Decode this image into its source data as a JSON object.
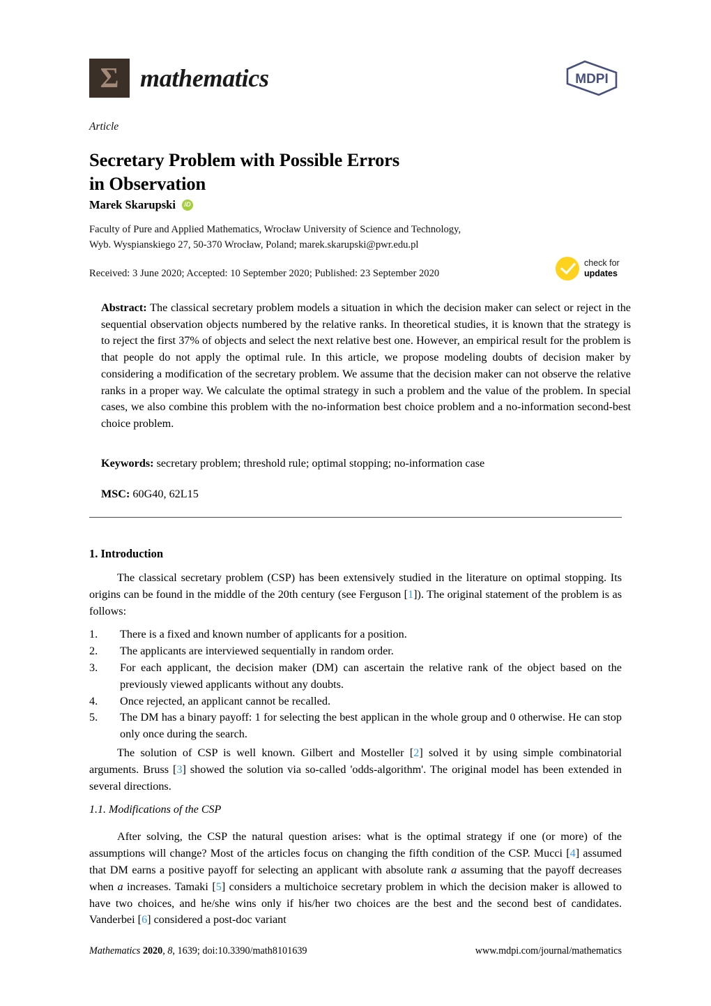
{
  "journal": {
    "logo_sigma": "Σ",
    "name": "mathematics",
    "publisher_logo_text": "MDPI"
  },
  "article": {
    "kind": "Article",
    "title_line1": "Secretary Problem with Possible Errors",
    "title_line2": "in Observation",
    "author": "Marek Skarupski",
    "orcid_label": "iD",
    "affiliation_line1": "Faculty of Pure and Applied Mathematics, Wrocław University of Science and Technology,",
    "affiliation_line2": "Wyb. Wyspianskiego 27, 50-370 Wrocław, Poland; marek.skarupski@pwr.edu.pl",
    "dates": "Received: 3 June 2020; Accepted: 10 September 2020; Published: 23 September 2020"
  },
  "check_updates": {
    "line1": "check for",
    "line2": "updates",
    "color": "#ffd21e"
  },
  "abstract": {
    "label": "Abstract:",
    "text": "The classical secretary problem models a situation in which the decision maker can select or reject in the sequential observation objects numbered by the relative ranks. In theoretical studies, it is known that the strategy is to reject the first 37% of objects and select the next relative best one. However, an empirical result for the problem is that people do not apply the optimal rule. In this article, we propose modeling doubts of decision maker by considering a modification of the secretary problem. We assume that the decision maker can not observe the relative ranks in a proper way. We calculate the optimal strategy in such a problem and the value of the problem. In special cases, we also combine this problem with the no-information best choice problem and a no-information second-best choice problem."
  },
  "keywords": {
    "label": "Keywords:",
    "text": "secretary problem; threshold rule; optimal stopping; no-information case"
  },
  "msc": {
    "label": "MSC:",
    "text": "60G40, 62L15"
  },
  "sections": {
    "intro_heading": "1. Introduction",
    "intro_para_a": "The classical secretary problem (CSP) has been extensively studied in the literature on optimal stopping. Its origins can be found in the middle of the 20th century (see Ferguson [",
    "intro_cite_1": "1",
    "intro_para_b": "]). The original statement of the problem is as follows:",
    "list": [
      {
        "num": "1.",
        "text": "There is a fixed and known number of applicants for a position."
      },
      {
        "num": "2.",
        "text": "The applicants are interviewed sequentially in random order."
      },
      {
        "num": "3.",
        "text": "For each applicant, the decision maker (DM) can ascertain the relative rank of the object based on the previously viewed applicants without any doubts."
      },
      {
        "num": "4.",
        "text": "Once rejected, an applicant cannot be recalled."
      },
      {
        "num": "5.",
        "text": "The DM has a binary payoff: 1 for selecting the best applican in the whole group and 0 otherwise. He can stop only once during the search."
      }
    ],
    "solution_para_a": "The solution of CSP is well known. Gilbert and Mosteller [",
    "solution_cite_2": "2",
    "solution_para_b": "] solved it by using simple combinatorial arguments. Bruss [",
    "solution_cite_3": "3",
    "solution_para_c": "] showed the solution via so-called 'odds-algorithm'. The original model has been extended in several directions.",
    "subsection_heading": "1.1. Modifications of the CSP",
    "mod_para_a": "After solving, the CSP the natural question arises: what is the optimal strategy if one (or more) of the assumptions will change? Most of the articles focus on changing the fifth condition of the CSP. Mucci [",
    "mod_cite_4": "4",
    "mod_para_b": "] assumed that DM earns a positive payoff for selecting an applicant with absolute rank ",
    "mod_var_a1": "a",
    "mod_para_c": " assuming that the payoff decreases when ",
    "mod_var_a2": "a",
    "mod_para_d": " increases. Tamaki [",
    "mod_cite_5": "5",
    "mod_para_e": "] considers a multichoice secretary problem in which the decision maker is allowed to have two choices, and he/she wins only if his/her two choices are the best and the second best of candidates. Vanderbei [",
    "mod_cite_6": "6",
    "mod_para_f": "] considered a post-doc variant"
  },
  "footer": {
    "left_journal": "Mathematics",
    "left_year": "2020",
    "left_vol": "8",
    "left_rest": ", 1639; doi:10.3390/math8101639",
    "right": "www.mdpi.com/journal/mathematics"
  },
  "colors": {
    "citation_link": "#3a9bdc",
    "orcid_green": "#a6ce39",
    "mdpi_navy": "#46507a",
    "logo_brown": "#3b3028",
    "logo_sigma": "#a38a78"
  }
}
